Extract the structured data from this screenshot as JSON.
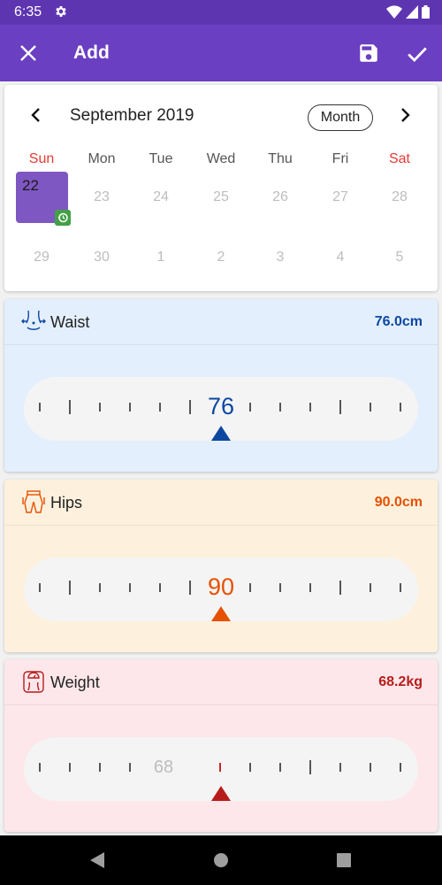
{
  "status_bar": {
    "time": "6:35"
  },
  "app_bar": {
    "title": "Add"
  },
  "calendar": {
    "month_label": "September 2019",
    "view_button": "Month",
    "weekdays": [
      "Sun",
      "Mon",
      "Tue",
      "Wed",
      "Thu",
      "Fri",
      "Sat"
    ],
    "week1": [
      "22",
      "23",
      "24",
      "25",
      "26",
      "27",
      "28"
    ],
    "week2": [
      "29",
      "30",
      "1",
      "2",
      "3",
      "4",
      "5"
    ],
    "selected_day": "22"
  },
  "measurements": [
    {
      "label": "Waist",
      "value": "76.0cm",
      "ruler_value": "76",
      "color": "#0d47a1",
      "background": "#e3effd"
    },
    {
      "label": "Hips",
      "value": "90.0cm",
      "ruler_value": "90",
      "color": "#e65100",
      "background": "#fdf1dd"
    },
    {
      "label": "Weight",
      "value": "68.2kg",
      "ruler_value": "68",
      "color": "#b71c1c",
      "background": "#fde7ea"
    }
  ],
  "colors": {
    "accent": "#6a3fc1",
    "status_bar": "#5e35b1",
    "weekend": "#e53935"
  }
}
